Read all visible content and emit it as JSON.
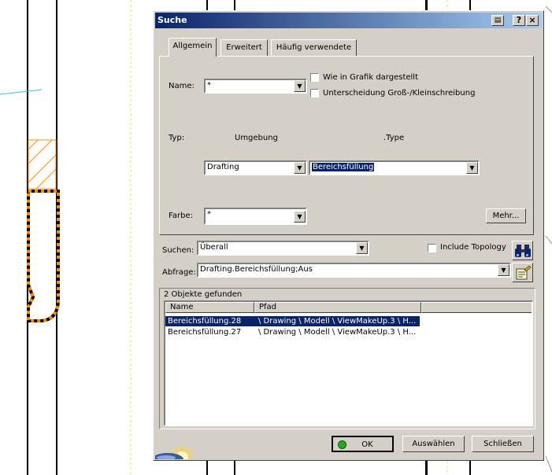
{
  "window": {
    "title": "Suche",
    "title_buttons": {
      "help": "?",
      "close": "×"
    }
  },
  "tabs": [
    {
      "label": "Allgemein",
      "active": true
    },
    {
      "label": "Erweitert",
      "active": false
    },
    {
      "label": "Häufig verwendete",
      "active": false
    }
  ],
  "general": {
    "name_label": "Name:",
    "name_value": "*",
    "check_graphic_label": "Wie in Grafik dargestellt",
    "check_case_label": "Unterscheidung Groß-/Kleinschreibung",
    "type_label": "Typ:",
    "environment_header": "Umgebung",
    "type_header": ".Type",
    "environment_value": "Drafting",
    "type_value": "Bereichsfüllung",
    "color_label": "Farbe:",
    "color_value": "*",
    "more_button": "Mehr..."
  },
  "search": {
    "label": "Suchen:",
    "value": "Überall",
    "include_topology_label": "Include Topology",
    "query_label": "Abfrage:",
    "query_value": "Drafting.Bereichsfüllung;Aus"
  },
  "results": {
    "count_text": "2 Objekte gefunden",
    "columns": [
      "Name",
      "Pfad"
    ],
    "rows": [
      {
        "name": "Bereichsfüllung.28",
        "path": "\\ Drawing \\ Modell \\ ViewMakeUp.3 \\ H...",
        "selected": true
      },
      {
        "name": "Bereichsfüllung.27",
        "path": "\\ Drawing \\ Modell \\ ViewMakeUp.3 \\ H...",
        "selected": false
      }
    ]
  },
  "footer": {
    "ok_label": "OK",
    "select_label": "Auswählen",
    "close_label": "Schließen"
  },
  "icons": {
    "title_icon": "print-icon",
    "search_icon": "binoculars-icon",
    "query_icon": "query-edit-icon",
    "ok_icon": "green-dot-icon"
  },
  "colors": {
    "title_start": "#0a246a",
    "title_end": "#a6caf0",
    "selection": "#0a246a",
    "orange_stroke": "#ff8c00",
    "ok_dot": "#22aa22"
  }
}
